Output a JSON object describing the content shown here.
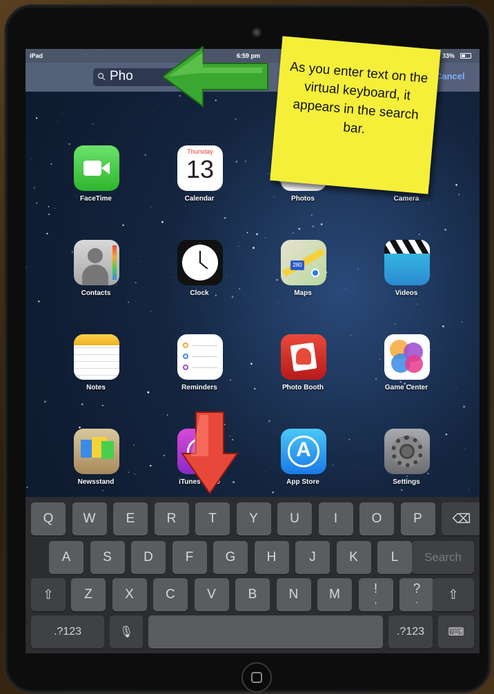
{
  "status_bar": {
    "carrier": "iPad",
    "time": "6:59 pm",
    "battery": "33%"
  },
  "search": {
    "query": "Pho",
    "cancel_label": "Cancel"
  },
  "callout": {
    "text": "As you enter text on the virtual keyboard, it appears in the search bar."
  },
  "apps": [
    {
      "label": "FaceTime",
      "icon": "facetime-icon"
    },
    {
      "label": "Calendar",
      "icon": "calendar-icon",
      "month_day": "Thursday",
      "date": "13"
    },
    {
      "label": "Photos",
      "icon": "photos-icon"
    },
    {
      "label": "Camera",
      "icon": "camera-icon"
    },
    {
      "label": "Contacts",
      "icon": "contacts-icon"
    },
    {
      "label": "Clock",
      "icon": "clock-icon"
    },
    {
      "label": "Maps",
      "icon": "maps-icon",
      "badge": "280"
    },
    {
      "label": "Videos",
      "icon": "videos-icon"
    },
    {
      "label": "Notes",
      "icon": "notes-icon"
    },
    {
      "label": "Reminders",
      "icon": "reminders-icon"
    },
    {
      "label": "Photo Booth",
      "icon": "photo-booth-icon"
    },
    {
      "label": "Game Center",
      "icon": "game-center-icon"
    },
    {
      "label": "Newsstand",
      "icon": "newsstand-icon"
    },
    {
      "label": "iTunes Store",
      "icon": "itunes-store-icon"
    },
    {
      "label": "App Store",
      "icon": "app-store-icon"
    },
    {
      "label": "Settings",
      "icon": "settings-icon"
    }
  ],
  "keyboard": {
    "row1": [
      "Q",
      "W",
      "E",
      "R",
      "T",
      "Y",
      "U",
      "I",
      "O",
      "P"
    ],
    "row2": [
      "A",
      "S",
      "D",
      "F",
      "G",
      "H",
      "J",
      "K",
      "L"
    ],
    "row3": [
      "Z",
      "X",
      "C",
      "V",
      "B",
      "N",
      "M",
      "!",
      "?"
    ],
    "row3_punct_sub": [
      ",",
      "."
    ],
    "search_label": "Search",
    "numbers_label": ".?123",
    "shift_glyph": "⇧",
    "backspace_glyph": "⌫",
    "mic_glyph": "🎙",
    "hide_keyboard_glyph": "⌨"
  },
  "colors": {
    "callout": "#f5ef3a",
    "green_arrow": "#3aa830",
    "red_arrow": "#e8483a",
    "cancel": "#7fb0ff"
  }
}
